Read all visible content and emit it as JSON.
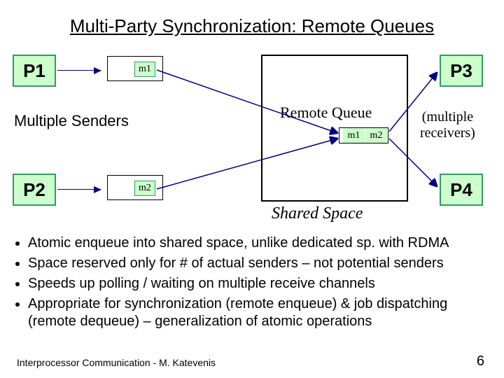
{
  "title": "Multi-Party Synchronization: Remote Queues",
  "proc": {
    "p1": "P1",
    "p2": "P2",
    "p3": "P3",
    "p4": "P4"
  },
  "msg": {
    "m1": "m1",
    "m2": "m2"
  },
  "labels": {
    "multiple_senders": "Multiple Senders",
    "remote_queue": "Remote Queue",
    "shared_space": "Shared Space",
    "multiple_receivers": "(multiple\nreceivers)"
  },
  "bullets": [
    "Atomic enqueue into shared space, unlike dedicated sp. with RDMA",
    "Space reserved only for # of actual senders – not potential senders",
    "Speeds up polling / waiting on multiple receive channels",
    "Appropriate for synchronization (remote enqueue) & job dispatching (remote dequeue) – generalization of atomic operations"
  ],
  "footer": {
    "left": "Interprocessor Communication - M. Katevenis",
    "right": "6"
  }
}
